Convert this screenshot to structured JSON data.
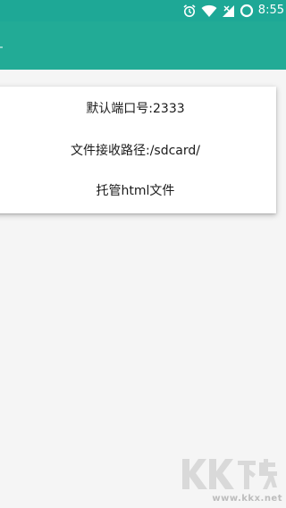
{
  "status_bar": {
    "time": "8:55",
    "icons": [
      "alarm-icon",
      "wifi-icon",
      "signal-icon",
      "battery-icon"
    ]
  },
  "card": {
    "port_text": "默认端口号:2333",
    "path_text": "文件接收路径:/sdcard/",
    "host_text": "托管html文件"
  },
  "watermark": {
    "logo_text": "KK下载",
    "url": "www.kkx.net"
  },
  "colors": {
    "status_bar": "#1ea896",
    "app_bar": "#22ab96",
    "background": "#f5f5f5",
    "card": "#ffffff"
  }
}
